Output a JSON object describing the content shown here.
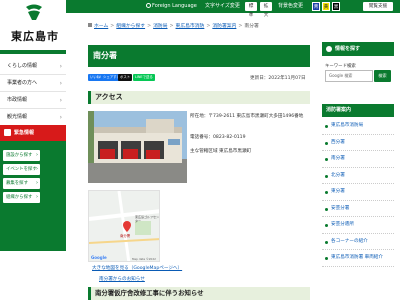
{
  "site": {
    "name": "東広島市"
  },
  "header": {
    "foreign_language": "Foreign Language",
    "font_size_label": "文字サイズ変更",
    "font_standard": "標準",
    "font_large": "拡大",
    "bg_color_label": "背景色変更",
    "bg_colors": [
      "青",
      "黄",
      "黒"
    ],
    "reading_support": "閲覧支援"
  },
  "sidebar": {
    "items": [
      {
        "label": "くらしの情報"
      },
      {
        "label": "事業者の方へ"
      },
      {
        "label": "市政情報"
      },
      {
        "label": "観光情報"
      }
    ],
    "emergency": "緊急情報",
    "find_buttons": [
      {
        "label": "施設から探す"
      },
      {
        "label": "イベントを探す"
      },
      {
        "label": "募集を探す"
      },
      {
        "label": "組織から探す"
      }
    ]
  },
  "breadcrumb": {
    "items": [
      "ホーム",
      "組織から探す",
      "消防局",
      "東広島市消防",
      "消防署案内",
      "南分署"
    ]
  },
  "main": {
    "title": "南分署",
    "share_buttons": [
      "いいね!",
      "シェアする",
      "ポスト",
      "LINEで送る"
    ],
    "updated": "更新日：2022年11月07日",
    "access_heading": "アクセス",
    "address": "所在地：〒739-2611 東広島市黒瀬町大多田1496番地",
    "phone": "電話番号：0823-82-0119",
    "area": "主な管轄区域 東広島市黒瀬町",
    "map_labels": {
      "map_place": "南分署",
      "shop": "東広島ゴルフセンター",
      "google": "Google",
      "copyright": "Map data ©2022"
    },
    "map_link_large": "大きな地図を見る（GoogleMapページへ）",
    "map_link_route": "南分署からのお知らせ",
    "notice_heading": "南分署仮庁舎改修工事に伴うお知らせ"
  },
  "right_column": {
    "find_info_heading": "情報を探す",
    "keyword_label": "キーワード検索",
    "search_placeholder": "Google 検索",
    "search_button": "検索",
    "guide_heading": "消防署案内",
    "links": [
      "東広島市消防局",
      "西分署",
      "南分署",
      "北分署",
      "東分署",
      "安芸分署",
      "安芸分遣所",
      "各コーナーの紹介",
      "東広島市消防署 車両紹介"
    ]
  },
  "colors": {
    "brand_green": "#0a7a2f",
    "emergency_red": "#d71a1a",
    "section_bg": "#e7f0dd",
    "link_blue": "#0a5bb5"
  },
  "icons": [
    "city-logo-icon",
    "globe-icon",
    "home-icon",
    "alert-icon",
    "search-icon",
    "map-pin-icon"
  ]
}
